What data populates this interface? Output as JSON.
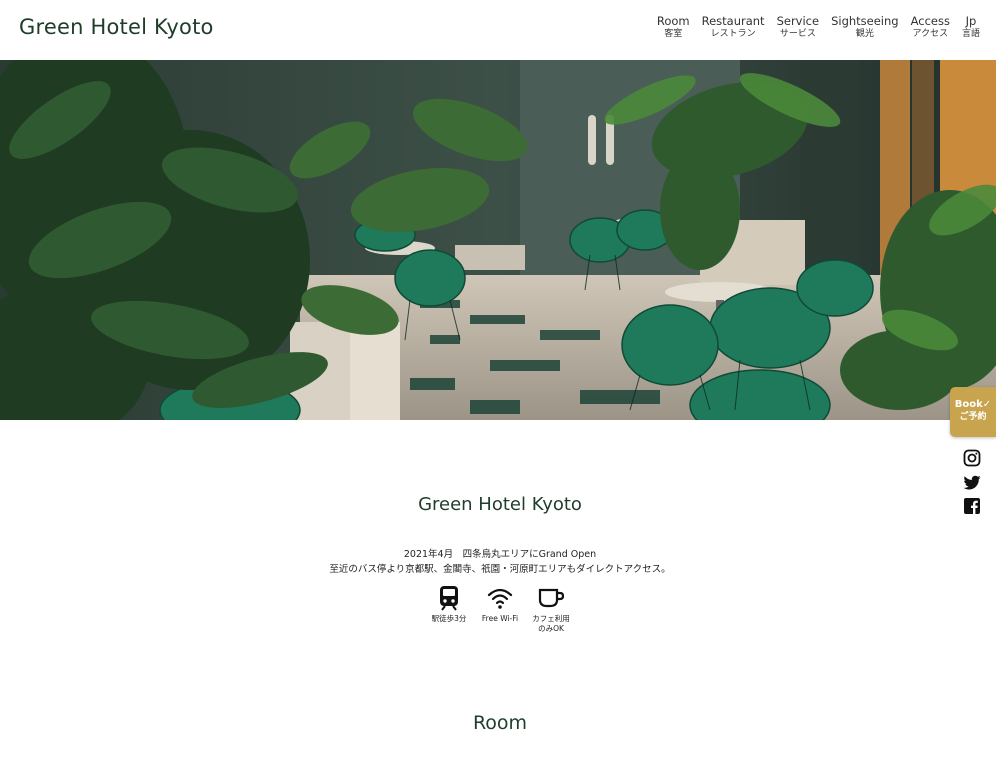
{
  "header": {
    "logo": "Green Hotel Kyoto",
    "nav": [
      {
        "en": "Room",
        "jp": "客室"
      },
      {
        "en": "Restaurant",
        "jp": "レストラン"
      },
      {
        "en": "Service",
        "jp": "サービス"
      },
      {
        "en": "Sightseeing",
        "jp": "観光"
      },
      {
        "en": "Access",
        "jp": "アクセス"
      },
      {
        "en": "Jp",
        "jp": "言語"
      }
    ]
  },
  "book": {
    "en": "Book✓",
    "jp": "ご予約"
  },
  "social": [
    "instagram-icon",
    "twitter-icon",
    "facebook-icon"
  ],
  "intro": {
    "title": "Green Hotel Kyoto",
    "line1": "2021年4月　四条烏丸エリアにGrand Open",
    "line2": "至近のバス停より京都駅、金閣寺、祇園・河原町エリアもダイレクトアクセス。",
    "features": [
      {
        "icon": "train-icon",
        "label": "駅徒歩3分",
        "label2": ""
      },
      {
        "icon": "wifi-icon",
        "label": "Free Wi-Fi",
        "label2": ""
      },
      {
        "icon": "cup-icon",
        "label": "カフェ利用",
        "label2": "のみOK"
      }
    ]
  },
  "room": {
    "title": "Room"
  },
  "colors": {
    "brand_green": "#1f3d2a",
    "book_gold": "#c9a44e",
    "chair_green": "#1f7a5c"
  }
}
